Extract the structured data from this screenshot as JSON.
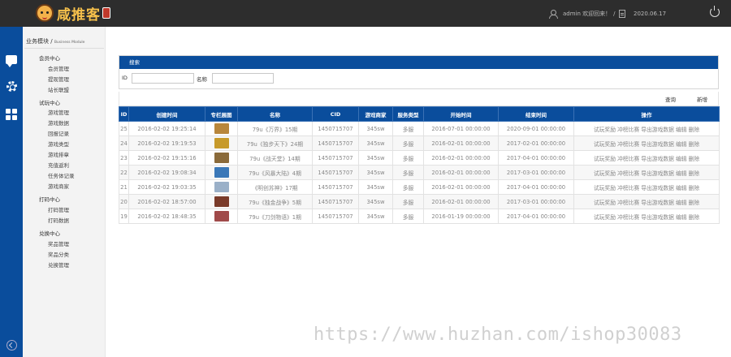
{
  "header": {
    "user_text": "admin 欢迎回来！",
    "date": "2020.06.17"
  },
  "sidebar": {
    "module_title": "业务模块",
    "module_subtitle": "Business Module",
    "groups": [
      {
        "label": "会员中心",
        "items": [
          "会员管理",
          "提现管理",
          "站长联盟"
        ]
      },
      {
        "label": "试玩中心",
        "items": [
          "游戏管理",
          "游戏数据",
          "回报记录",
          "游戏类型",
          "游戏排章",
          "充值返利",
          "任务体记录",
          "游戏商家"
        ]
      },
      {
        "label": "打码中心",
        "items": [
          "打码管理",
          "打码数据"
        ]
      },
      {
        "label": "兑换中心",
        "items": [
          "奖品管理",
          "奖品分类",
          "兑换管理"
        ]
      }
    ]
  },
  "search": {
    "title": "搜索",
    "id_label": "ID",
    "id_value": "",
    "name_label": "名称",
    "name_value": "",
    "query_button": "查询",
    "add_button": "新增"
  },
  "table": {
    "columns": [
      "ID",
      "创建时间",
      "专栏展图",
      "名称",
      "CID",
      "游戏商家",
      "服务类型",
      "开始时间",
      "结束时间",
      "操作"
    ],
    "operations": [
      "试玩奖励",
      "冲榜比赛",
      "导出游戏数据",
      "编辑",
      "删除"
    ],
    "rows": [
      {
        "id": "25",
        "created": "2016-02-02 19:25:14",
        "thumb_color": "#b8863b",
        "name": "79u《万界》15期",
        "cid": "1450715707",
        "vendor": "345sw",
        "service": "多服",
        "start": "2016-07-01 00:00:00",
        "end": "2020-09-01 00:00:00"
      },
      {
        "id": "24",
        "created": "2016-02-02 19:19:53",
        "thumb_color": "#c79a2a",
        "name": "79u《独步天下》24期",
        "cid": "1450715707",
        "vendor": "345sw",
        "service": "多服",
        "start": "2016-02-01 00:00:00",
        "end": "2017-02-01 00:00:00"
      },
      {
        "id": "23",
        "created": "2016-02-02 19:15:16",
        "thumb_color": "#8a6a3a",
        "name": "79u《战天堂》14期",
        "cid": "1450715707",
        "vendor": "345sw",
        "service": "多服",
        "start": "2016-02-01 00:00:00",
        "end": "2017-04-01 00:00:00"
      },
      {
        "id": "22",
        "created": "2016-02-02 19:08:34",
        "thumb_color": "#3a78b8",
        "name": "79u《风暴大陆》4期",
        "cid": "1450715707",
        "vendor": "345sw",
        "service": "多服",
        "start": "2016-02-01 00:00:00",
        "end": "2017-03-01 00:00:00"
      },
      {
        "id": "21",
        "created": "2016-02-02 19:03:35",
        "thumb_color": "#9ab0c8",
        "name": "《明创苏神》17期",
        "cid": "1450715707",
        "vendor": "345sw",
        "service": "多服",
        "start": "2016-02-01 00:00:00",
        "end": "2017-04-01 00:00:00"
      },
      {
        "id": "20",
        "created": "2016-02-02 18:57:00",
        "thumb_color": "#7a3b2a",
        "name": "79u《独金战争》5期",
        "cid": "1450715707",
        "vendor": "345sw",
        "service": "多服",
        "start": "2016-02-01 00:00:00",
        "end": "2017-03-01 00:00:00"
      },
      {
        "id": "19",
        "created": "2016-02-02 18:48:35",
        "thumb_color": "#a04a4a",
        "name": "79u《刀剑物语》1期",
        "cid": "1450715707",
        "vendor": "345sw",
        "service": "多服",
        "start": "2016-01-19 00:00:00",
        "end": "2017-04-01 00:00:00"
      }
    ]
  },
  "watermark": "https://www.huzhan.com/ishop30083",
  "colors": {
    "accent": "#0a4d9c",
    "topbar": "#2d2d2d"
  }
}
